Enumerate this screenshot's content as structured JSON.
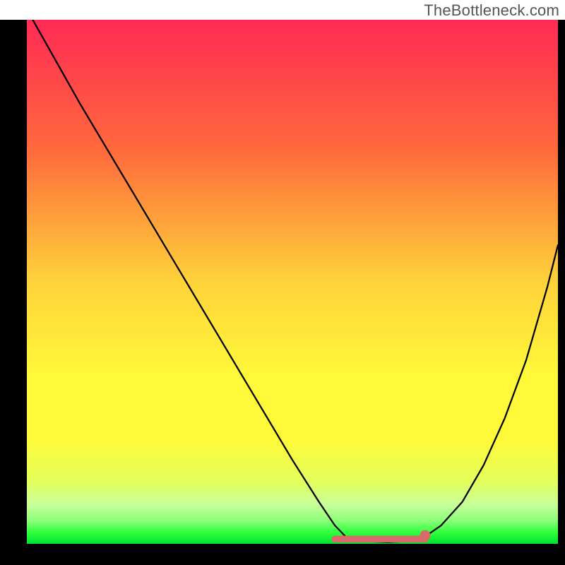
{
  "watermark": "TheBottleneck.com",
  "colors": {
    "frame": "#000000",
    "grad_top": "#ff2a55",
    "grad_mid1": "#ff6a3c",
    "grad_mid2": "#ffd23a",
    "grad_mid3": "#fff93a",
    "grad_mid4": "#e3ff5a",
    "grad_green_pale": "#c8ff9a",
    "grad_green_light": "#8dff7a",
    "grad_green": "#2bff3a",
    "grad_green_deep": "#00e030",
    "curve": "#000000",
    "marker_stroke": "#d86a6a",
    "marker_fill": "#d86a6a"
  },
  "chart_data": {
    "type": "line",
    "title": "",
    "xlabel": "",
    "ylabel": "",
    "xlim": [
      0,
      100
    ],
    "ylim": [
      0,
      100
    ],
    "series": [
      {
        "name": "bottleneck-curve",
        "x": [
          0,
          5,
          10,
          15,
          20,
          25,
          30,
          35,
          40,
          45,
          50,
          55,
          58,
          60,
          63,
          68,
          72,
          75,
          78,
          82,
          86,
          90,
          94,
          98,
          100
        ],
        "y": [
          102,
          93,
          84,
          75.5,
          67,
          58.5,
          50,
          41.5,
          33,
          24.5,
          16,
          8,
          3.5,
          1.4,
          0.5,
          0.3,
          0.5,
          1.4,
          3.5,
          8,
          15,
          24,
          35,
          49,
          57
        ]
      }
    ],
    "flat_region": {
      "x_start": 58,
      "x_end": 75,
      "y": 0.9
    },
    "end_marker": {
      "x": 75,
      "y": 1.6
    }
  }
}
